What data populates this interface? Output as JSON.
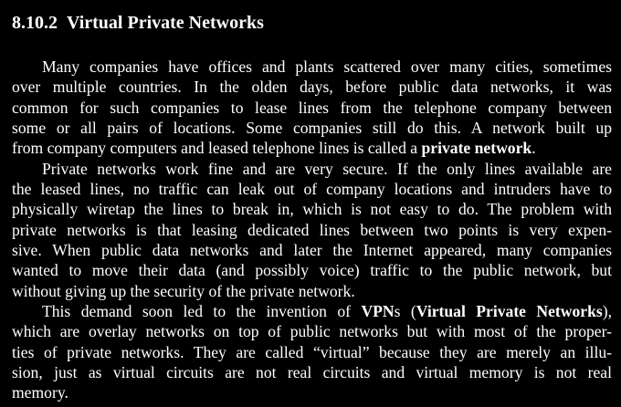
{
  "section": {
    "number": "8.10.2",
    "title": "Virtual Private Networks"
  },
  "paragraphs": [
    {
      "lines": [
        [
          "Many companies have offices and plants scattered over many cities, sometimes"
        ],
        [
          "over multiple countries.  In the olden days, before public data networks, it was"
        ],
        [
          "common for such companies to lease lines from the telephone company between"
        ],
        [
          "some or all pairs of locations.  Some companies still do this.  A network built up"
        ],
        [
          "from company computers and leased telephone lines is called a ",
          {
            "b": "private network"
          },
          "."
        ]
      ]
    },
    {
      "lines": [
        [
          "Private networks work fine and are very secure.  If the only lines available are"
        ],
        [
          "the leased lines, no traffic can leak out of company locations and intruders have to"
        ],
        [
          "physically wiretap the lines to break in, which is not easy to do.  The problem with"
        ],
        [
          "private networks is that leasing dedicated lines between two points is very expen-"
        ],
        [
          "sive.  When public data networks and later the Internet appeared, many companies"
        ],
        [
          "wanted to move their data (and possibly voice) traffic to the public network, but"
        ],
        [
          "without giving up the security of the private network."
        ]
      ]
    },
    {
      "lines": [
        [
          "This demand soon led to the invention of ",
          {
            "b": "VPN"
          },
          "s (",
          {
            "b": "Virtual Private Networks"
          },
          "),"
        ],
        [
          "which are overlay networks on top of public networks but with most of the proper-"
        ],
        [
          "ties of private networks.  They are called “virtual” because they are merely an illu-"
        ],
        [
          "sion, just as virtual circuits are not real circuits and virtual memory is not real"
        ],
        [
          "memory."
        ]
      ]
    }
  ]
}
